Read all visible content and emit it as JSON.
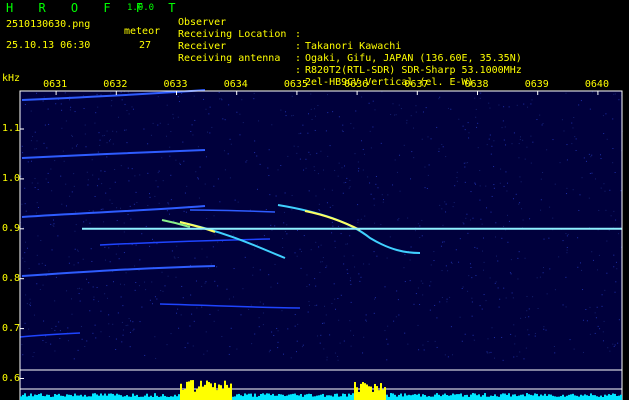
{
  "app": {
    "title": "H R O F F T",
    "version": "1.0.0",
    "filename": "2510130630.png",
    "datetime": "25.10.13 06:30",
    "meteor_label": "meteor",
    "meteor_count": "27"
  },
  "info": [
    {
      "label": "Observer",
      "sep": ":",
      "value": "Takanori Kawachi"
    },
    {
      "label": "Receiving Location",
      "sep": ":",
      "value": "Ogaki, Gifu, JAPAN (136.60E, 35.35N)"
    },
    {
      "label": "Receiver",
      "sep": ":",
      "value": "R820T2(RTL-SDR) SDR-Sharp 53.1000MHz"
    },
    {
      "label": "Receiving antenna",
      "sep": ":",
      "value": "2el-HB9CV Vertical (el. E-W)"
    }
  ],
  "chart_data": {
    "type": "spectrogram",
    "ylabel": "kHz",
    "x_ticks": [
      "0631",
      "0632",
      "0633",
      "0634",
      "0635",
      "0636",
      "0637",
      "0638",
      "0639",
      "0640"
    ],
    "y_ticks": [
      "1.1",
      "1.0",
      "0.9",
      "0.8",
      "0.7",
      "0.6"
    ],
    "ylim": [
      0.6,
      1.17
    ],
    "carrier_khz": 0.9,
    "colors": {
      "background": "#00003c",
      "carrier": "#8ff0ff",
      "axis": "#ffffff",
      "text": "#ffff00",
      "title": "#00ff00",
      "activity": "#00e5ff",
      "activity_peak": "#ffff00"
    }
  }
}
